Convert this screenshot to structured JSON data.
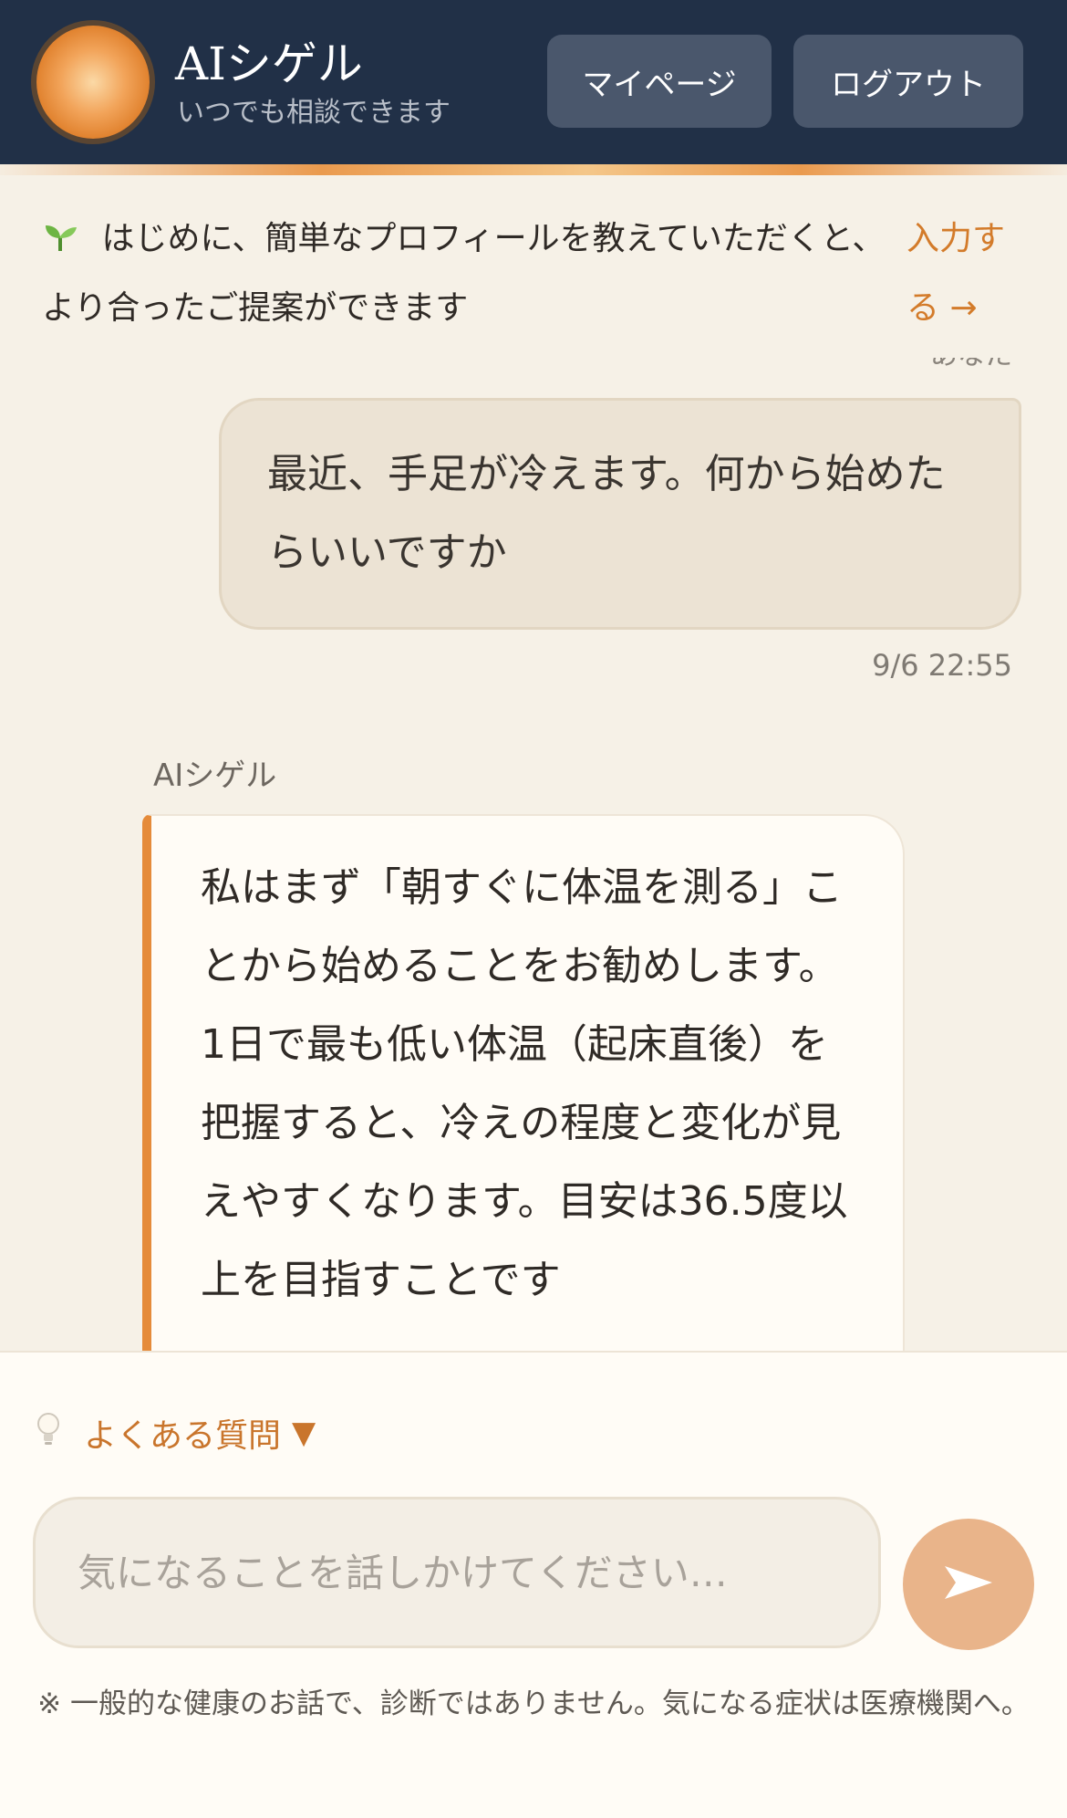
{
  "header": {
    "title": "AIシゲル",
    "subtitle": "いつでも相談できます",
    "mypage_label": "マイページ",
    "logout_label": "ログアウト",
    "avatar_icon": "orange-orb-avatar"
  },
  "notice": {
    "icon": "sprout-icon",
    "text": "はじめに、簡単なプロフィールを教えていただくと、より合ったご提案ができます",
    "link_label": "入力する →"
  },
  "messages": {
    "cut_timestamp": "あなた",
    "user": {
      "text": "最近、手足が冷えます。何から始めたらいいですか",
      "timestamp": "9/6 22:55"
    },
    "ai": {
      "sender": "AIシゲル",
      "text": "私はまず「朝すぐに体温を測る」ことから始めることをお勧めします。1日で最も低い体温（起床直後）を把握すると、冷えの程度と変化が見えやすくなります。目安は36.5度以上を目指すことです"
    }
  },
  "composer": {
    "faq_label": "よくある質問",
    "faq_icon": "lightbulb-icon",
    "placeholder": "気になることを話しかけてください…",
    "send_icon": "send-arrow-icon",
    "disclaimer": "※ 一般的な健康のお話で、診断ではありません。気になる症状は医療機関へ。"
  },
  "colors": {
    "header_bg": "#213047",
    "accent": "#e58b3a",
    "background": "#f6f1e7"
  }
}
